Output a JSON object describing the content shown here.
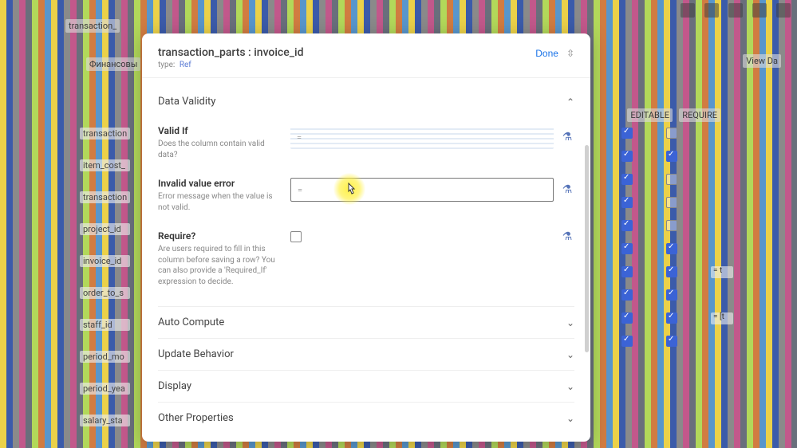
{
  "header": {
    "title": "transaction_parts : invoice_id",
    "type_label": "type:",
    "type_value": "Ref",
    "done": "Done"
  },
  "background": {
    "breadcrumb": "transaction_",
    "sub": "Финансовы",
    "cols_right": [
      "EDITABLE",
      "REQUIRE"
    ],
    "rows": [
      "transaction",
      "item_cost_",
      "transaction",
      "project_id",
      "invoice_id",
      "order_to_s",
      "staff_id",
      "period_mo",
      "period_yea",
      "salary_sta"
    ],
    "view_btn": "View Da",
    "eq1": "= t",
    "eq2": "= [t"
  },
  "sections": {
    "data_validity": {
      "title": "Data Validity",
      "valid_if": {
        "label": "Valid If",
        "help": "Does the column contain valid data?"
      },
      "invalid_err": {
        "label": "Invalid value error",
        "help": "Error message when the value is not valid."
      },
      "require": {
        "label": "Require?",
        "help": "Are users required to fill in this column before saving a row? You can also provide a 'Required_If' expression to decide."
      }
    },
    "auto_compute": "Auto Compute",
    "update_behavior": "Update Behavior",
    "display": "Display",
    "other_props": "Other Properties"
  },
  "symbols": {
    "eq": "="
  }
}
